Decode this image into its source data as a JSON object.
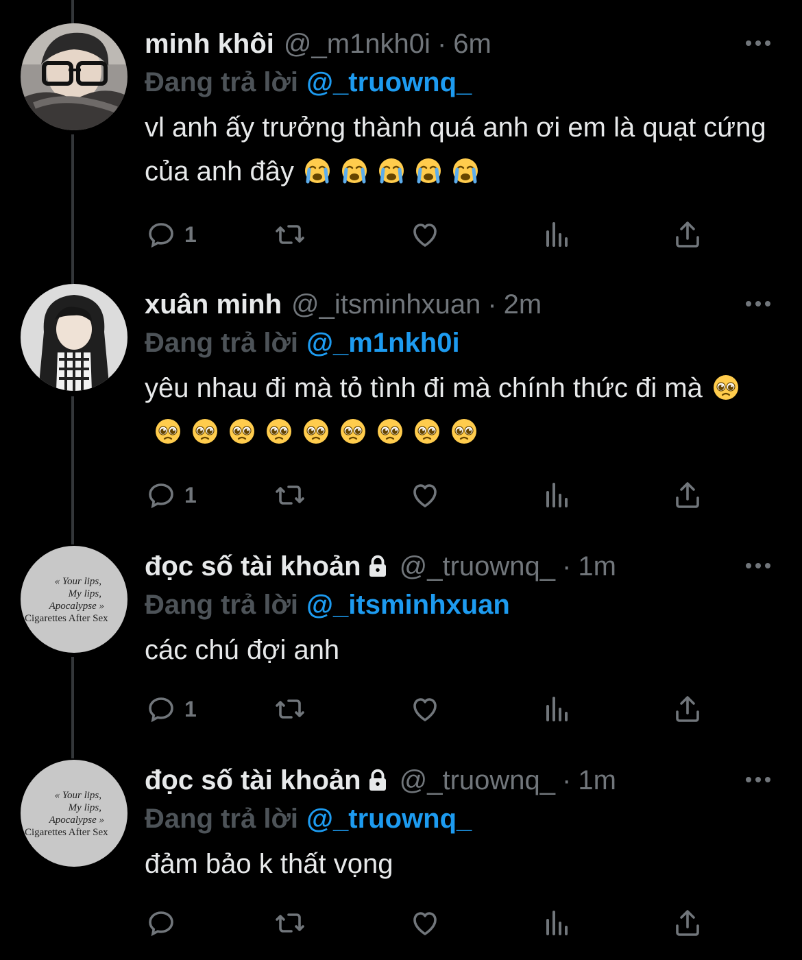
{
  "theme": {
    "background": "#000000",
    "text": "#e7e9ea",
    "muted": "#71767b",
    "accent": "#1d9bf0",
    "reply_label": "#4d5358",
    "thread_line": "#333639"
  },
  "reply_prefix": "Đang trả lời",
  "tweets": [
    {
      "name": "minh khôi",
      "locked": false,
      "handle": "@_m1nkh0i",
      "time": "6m",
      "reply_to": "@_truownq_",
      "text": "vl anh ấy trưởng thành quá anh ơi em là quạt cứng của anh đây",
      "emoji": "crying-face-emoji",
      "emoji_count": 5,
      "reply_count": "1",
      "avatar": "photo-person-glasses"
    },
    {
      "name": "xuân minh",
      "locked": false,
      "handle": "@_itsminhxuan",
      "time": "2m",
      "reply_to": "@_m1nkh0i",
      "text": "yêu nhau đi mà tỏ tình đi mà chính thức đi mà",
      "emoji": "pleading-face-emoji",
      "emoji_count": 10,
      "reply_count": "1",
      "avatar": "photo-person-hoodie"
    },
    {
      "name": "đọc số tài khoản",
      "locked": true,
      "handle": "@_truownq_",
      "time": "1m",
      "reply_to": "@_itsminhxuan",
      "text": "các chú đợi anh",
      "emoji": "",
      "emoji_count": 0,
      "reply_count": "1",
      "avatar": "album-text",
      "avatar_text": [
        "« Your lips,",
        "My lips,",
        "Apocalypse »",
        "Cigarettes After Sex"
      ]
    },
    {
      "name": "đọc số tài khoản",
      "locked": true,
      "handle": "@_truownq_",
      "time": "1m",
      "reply_to": "@_truownq_",
      "text": "đảm bảo k thất vọng",
      "emoji": "",
      "emoji_count": 0,
      "reply_count": "",
      "avatar": "album-text",
      "avatar_text": [
        "« Your lips,",
        "My lips,",
        "Apocalypse »",
        "Cigarettes After Sex"
      ]
    }
  ]
}
